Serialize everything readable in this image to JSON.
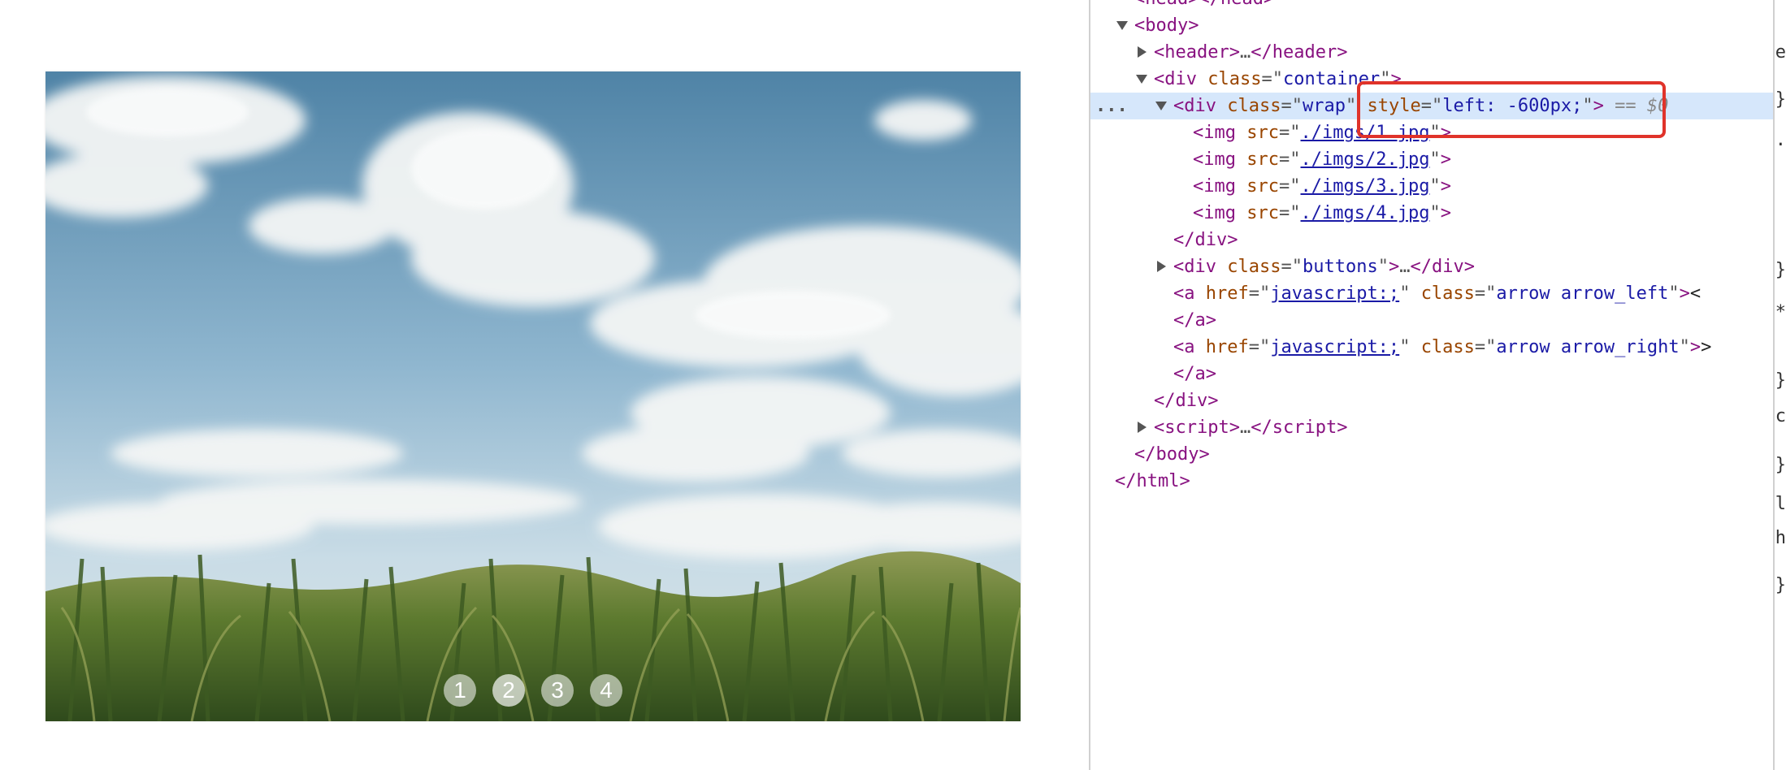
{
  "page": {
    "carousel": {
      "image_alt": "Cornfield under blue sky with clouds",
      "dots": [
        "1",
        "2",
        "3",
        "4"
      ],
      "active_dot_index": 1
    }
  },
  "devtools": {
    "lines": {
      "head": "<head></head>",
      "body_open": "body",
      "header_tag": "header",
      "header_close": "header",
      "div": "div",
      "class_attr": "class",
      "style_attr": "style",
      "src_attr": "src",
      "href_attr": "href",
      "container_val": "container",
      "wrap_val": "wrap",
      "style_val": "left: -600px;",
      "dollar0": "== $0",
      "img": "img",
      "img1": "./imgs/1.jpg",
      "img2": "./imgs/2.jpg",
      "img3": "./imgs/3.jpg",
      "img4": "./imgs/4.jpg",
      "buttons_val": "buttons",
      "a": "a",
      "js_href": "javascript:;",
      "arrow_left_val": "arrow arrow_left",
      "arrow_right_val": "arrow arrow_right",
      "arrow_left_text": "<",
      "arrow_right_text": ">",
      "script": "script",
      "body_close": "body",
      "html_close": "html",
      "ellipsis": "…",
      "more": "..."
    },
    "styles_edge_glyphs": [
      "e",
      "}",
      ".",
      "}",
      "*",
      "}",
      "c",
      "}",
      "l",
      "h",
      "}"
    ]
  }
}
